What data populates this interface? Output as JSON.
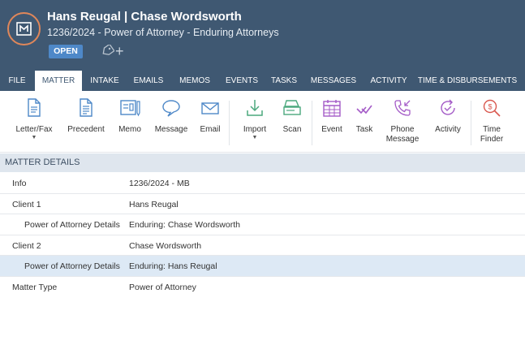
{
  "matter": {
    "title": "Hans Reugal | Chase Wordsworth",
    "subtitle": "1236/2024 - Power of Attorney - Enduring Attorneys",
    "status": "OPEN"
  },
  "tabs": [
    "FILE",
    "MATTER",
    "INTAKE",
    "EMAILS",
    "MEMOS",
    "EVENTS",
    "TASKS",
    "MESSAGES",
    "ACTIVITY",
    "TIME & DISBURSEMENTS"
  ],
  "active_tab": "MATTER",
  "toolbar": {
    "letter_fax": "Letter/Fax",
    "precedent": "Precedent",
    "memo": "Memo",
    "message": "Message",
    "email": "Email",
    "import": "Import",
    "scan": "Scan",
    "event": "Event",
    "task": "Task",
    "phone_message_1": "Phone",
    "phone_message_2": "Message",
    "activity": "Activity",
    "time_finder_1": "Time",
    "time_finder_2": "Finder"
  },
  "section_title": "MATTER DETAILS",
  "details": [
    {
      "label": "Info",
      "value": "1236/2024 - MB"
    },
    {
      "label": "Client 1",
      "value": "Hans Reugal"
    },
    {
      "label": "Power of Attorney Details",
      "value": "Enduring: Chase Wordsworth"
    },
    {
      "label": "Client 2",
      "value": "Chase Wordsworth"
    },
    {
      "label": "Power of Attorney Details",
      "value": "Enduring: Hans Reugal"
    },
    {
      "label": "Matter Type",
      "value": "Power of Attorney"
    }
  ],
  "colors": {
    "header_bg": "#3f5872",
    "status_badge": "#4e88c8",
    "logo_ring": "#e0875a",
    "selected_row": "#dde9f5",
    "section_bg": "#dfe6ee"
  }
}
